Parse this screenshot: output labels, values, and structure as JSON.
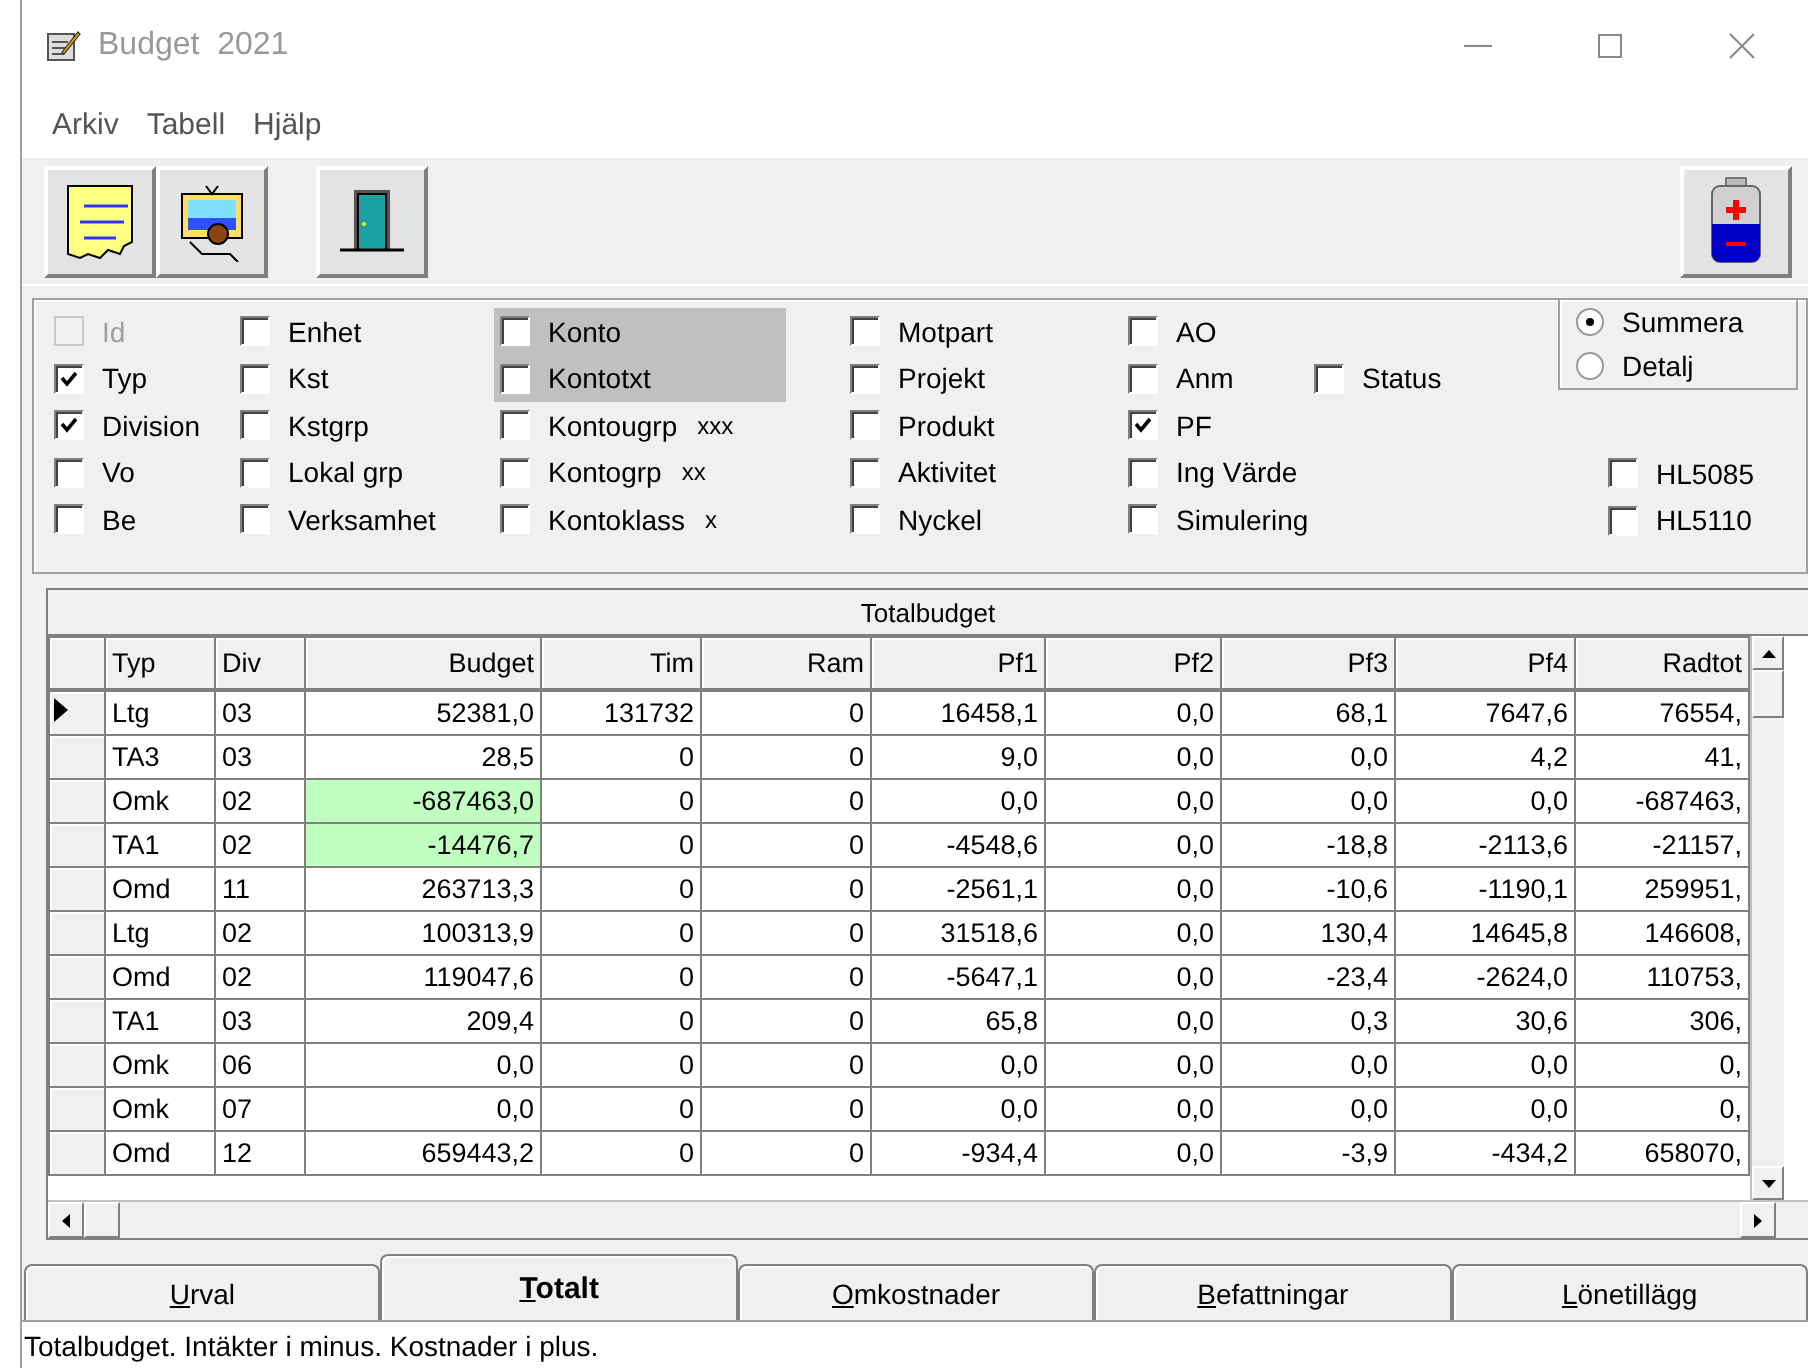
{
  "window": {
    "title": "Budget  2021"
  },
  "menu": [
    "Arkiv",
    "Tabell",
    "Hjälp"
  ],
  "options": {
    "columns": [
      [
        {
          "label": "Id",
          "checked": false,
          "disabled": true,
          "highlighted": false
        },
        {
          "label": "Typ",
          "checked": true,
          "disabled": false,
          "highlighted": false
        },
        {
          "label": "Division",
          "checked": true,
          "disabled": false,
          "highlighted": false
        },
        {
          "label": "Vo",
          "checked": false,
          "disabled": false,
          "highlighted": false
        },
        {
          "label": "Be",
          "checked": false,
          "disabled": false,
          "highlighted": false
        }
      ],
      [
        {
          "label": "Enhet",
          "checked": false,
          "disabled": false,
          "highlighted": false
        },
        {
          "label": "Kst",
          "checked": false,
          "disabled": false,
          "highlighted": false
        },
        {
          "label": "Kstgrp",
          "checked": false,
          "disabled": false,
          "highlighted": false
        },
        {
          "label": "Lokal grp",
          "checked": false,
          "disabled": false,
          "highlighted": false
        },
        {
          "label": "Verksamhet",
          "checked": false,
          "disabled": false,
          "highlighted": false
        }
      ],
      [
        {
          "label": "Konto",
          "checked": false,
          "disabled": false,
          "highlighted": true
        },
        {
          "label": "Kontotxt",
          "checked": false,
          "disabled": false,
          "highlighted": true
        },
        {
          "label": "Kontougrp",
          "suffix": "xxx",
          "checked": false,
          "disabled": false,
          "highlighted": false
        },
        {
          "label": "Kontogrp",
          "suffix": "xx",
          "checked": false,
          "disabled": false,
          "highlighted": false
        },
        {
          "label": "Kontoklass",
          "suffix": "x",
          "checked": false,
          "disabled": false,
          "highlighted": false
        }
      ],
      [
        {
          "label": "Motpart",
          "checked": false,
          "disabled": false,
          "highlighted": false
        },
        {
          "label": "Projekt",
          "checked": false,
          "disabled": false,
          "highlighted": false
        },
        {
          "label": "Produkt",
          "checked": false,
          "disabled": false,
          "highlighted": false
        },
        {
          "label": "Aktivitet",
          "checked": false,
          "disabled": false,
          "highlighted": false
        },
        {
          "label": "Nyckel",
          "checked": false,
          "disabled": false,
          "highlighted": false
        }
      ],
      [
        {
          "label": "AO",
          "checked": false,
          "disabled": false,
          "highlighted": false
        },
        {
          "label": "Anm",
          "checked": false,
          "disabled": false,
          "highlighted": false
        },
        {
          "label": "PF",
          "checked": true,
          "disabled": false,
          "highlighted": false
        },
        {
          "label": "Ing Värde",
          "checked": false,
          "disabled": false,
          "highlighted": false
        },
        {
          "label": "Simulering",
          "checked": false,
          "disabled": false,
          "highlighted": false
        }
      ]
    ],
    "status_checkbox": {
      "label": "Status",
      "checked": false
    },
    "mode": [
      {
        "label": "Summera",
        "selected": true
      },
      {
        "label": "Detalj",
        "selected": false
      }
    ],
    "hl_checkboxes": [
      {
        "label": "HL5085",
        "checked": false
      },
      {
        "label": "HL5110",
        "checked": false
      }
    ]
  },
  "table": {
    "title": "Totalbudget",
    "columns": [
      "Typ",
      "Div",
      "Budget",
      "Tim",
      "Ram",
      "Pf1",
      "Pf2",
      "Pf3",
      "Pf4",
      "Radtot"
    ],
    "rows": [
      {
        "current": true,
        "budget_highlighted": false,
        "cells": [
          "Ltg",
          "03",
          "52381,0",
          "131732",
          "0",
          "16458,1",
          "0,0",
          "68,1",
          "7647,6",
          "76554,"
        ]
      },
      {
        "current": false,
        "budget_highlighted": false,
        "cells": [
          "TA3",
          "03",
          "28,5",
          "0",
          "0",
          "9,0",
          "0,0",
          "0,0",
          "4,2",
          "41,"
        ]
      },
      {
        "current": false,
        "budget_highlighted": true,
        "cells": [
          "Omk",
          "02",
          "-687463,0",
          "0",
          "0",
          "0,0",
          "0,0",
          "0,0",
          "0,0",
          "-687463,"
        ]
      },
      {
        "current": false,
        "budget_highlighted": true,
        "cells": [
          "TA1",
          "02",
          "-14476,7",
          "0",
          "0",
          "-4548,6",
          "0,0",
          "-18,8",
          "-2113,6",
          "-21157,"
        ]
      },
      {
        "current": false,
        "budget_highlighted": false,
        "cells": [
          "Omd",
          "11",
          "263713,3",
          "0",
          "0",
          "-2561,1",
          "0,0",
          "-10,6",
          "-1190,1",
          "259951,"
        ]
      },
      {
        "current": false,
        "budget_highlighted": false,
        "cells": [
          "Ltg",
          "02",
          "100313,9",
          "0",
          "0",
          "31518,6",
          "0,0",
          "130,4",
          "14645,8",
          "146608,"
        ]
      },
      {
        "current": false,
        "budget_highlighted": false,
        "cells": [
          "Omd",
          "02",
          "119047,6",
          "0",
          "0",
          "-5647,1",
          "0,0",
          "-23,4",
          "-2624,0",
          "110753,"
        ]
      },
      {
        "current": false,
        "budget_highlighted": false,
        "cells": [
          "TA1",
          "03",
          "209,4",
          "0",
          "0",
          "65,8",
          "0,0",
          "0,3",
          "30,6",
          "306,"
        ]
      },
      {
        "current": false,
        "budget_highlighted": false,
        "cells": [
          "Omk",
          "06",
          "0,0",
          "0",
          "0",
          "0,0",
          "0,0",
          "0,0",
          "0,0",
          "0,"
        ]
      },
      {
        "current": false,
        "budget_highlighted": false,
        "cells": [
          "Omk",
          "07",
          "0,0",
          "0",
          "0",
          "0,0",
          "0,0",
          "0,0",
          "0,0",
          "0,"
        ]
      },
      {
        "current": false,
        "budget_highlighted": false,
        "cells": [
          "Omd",
          "12",
          "659443,2",
          "0",
          "0",
          "-934,4",
          "0,0",
          "-3,9",
          "-434,2",
          "658070,"
        ]
      }
    ]
  },
  "tabs": [
    {
      "label": "Urval",
      "selected": false
    },
    {
      "label": "Totalt",
      "selected": true
    },
    {
      "label": "Omkostnader",
      "selected": false
    },
    {
      "label": "Befattningar",
      "selected": false
    },
    {
      "label": "Lönetillägg",
      "selected": false
    }
  ],
  "status_bar": "Totalbudget. Intäkter i minus. Kostnader i plus."
}
